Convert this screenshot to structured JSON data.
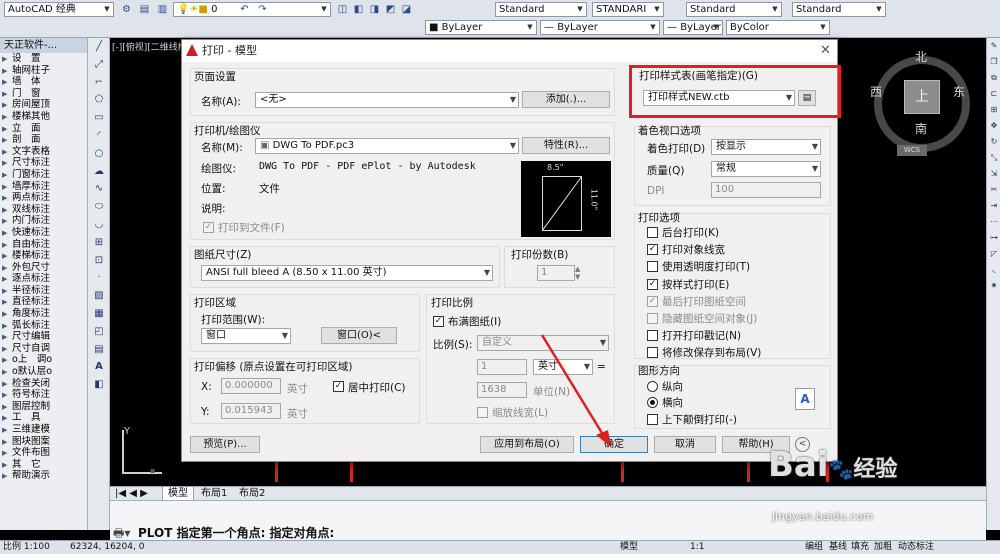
{
  "app": {
    "workspace": "AutoCAD 经典",
    "layer_value": "0",
    "style_combos": [
      "Standard",
      "STANDARI",
      "Standard",
      "Standard"
    ],
    "layer_combos": [
      "ByLayer",
      "ByLayer",
      "ByLayer",
      "ByColor"
    ]
  },
  "left_panel": {
    "title": "天正软件-...",
    "items": [
      "设　置",
      "轴网柱子",
      "墙　体",
      "门　窗",
      "房间屋顶",
      "楼梯其他",
      "立　面",
      "剖　面",
      "文字表格",
      "尺寸标注",
      "门窗标注",
      "墙厚标注",
      "两点标注",
      "双线标注",
      "内门标注",
      "快速标注",
      "自由标注",
      "楼梯标注",
      "外包尺寸",
      "逐点标注",
      "半径标注",
      "直径标注",
      "角度标注",
      "弧长标注",
      "尺寸编辑",
      "尺寸自调",
      "o上　调o",
      "o默认层o",
      "检查关闭",
      "符号标注",
      "图层控制",
      "工　具",
      "三维建模",
      "图块图案",
      "文件布图",
      "其　它",
      "帮助演示"
    ]
  },
  "viewport_label": "[-][俯视][二维线框]",
  "compass": {
    "north": "北",
    "south": "南",
    "west": "西",
    "east": "东",
    "center": "上",
    "wcs": "WCS"
  },
  "ucs": {
    "y_label": "Y"
  },
  "tabs": [
    "模型",
    "布局1",
    "布局2"
  ],
  "command": {
    "text": "PLOT 指定第一个角点: 指定对角点:"
  },
  "status": {
    "scale": "比例 1:100",
    "coords": "62324, 16204, 0",
    "model": "模型",
    "anno_scale": "1:1",
    "right_items": [
      "编组",
      "基线",
      "填充",
      "加粗",
      "动态标注"
    ]
  },
  "watermark": {
    "brand": "Bai",
    "brand_cn": "经验",
    "url": "jingyan.baidu.com"
  },
  "dialog": {
    "title": "打印 - 模型",
    "page_setup": {
      "group": "页面设置",
      "name_label": "名称(A):",
      "name_value": "<无>",
      "add_button": "添加(.)..."
    },
    "printer": {
      "group": "打印机/绘图仪",
      "name_label": "名称(M):",
      "name_value": "DWG To PDF.pc3",
      "props_button": "特性(R)...",
      "plotter_label": "绘图仪:",
      "plotter_value": "DWG To PDF - PDF ePlot - by Autodesk",
      "location_label": "位置:",
      "location_value": "文件",
      "desc_label": "说明:",
      "print_to_file": "打印到文件(F)",
      "preview_w": "8.5\"",
      "preview_h": "11.0\""
    },
    "paper_size": {
      "group": "图纸尺寸(Z)",
      "value": "ANSI full bleed A (8.50 x 11.00 英寸)"
    },
    "copies": {
      "group": "打印份数(B)",
      "value": "1"
    },
    "plot_area": {
      "group": "打印区域",
      "range_label": "打印范围(W):",
      "range_value": "窗口",
      "window_button": "窗口(O)<"
    },
    "plot_offset": {
      "group": "打印偏移 (原点设置在可打印区域)",
      "x_label": "X:",
      "x_value": "0.000000",
      "x_unit": "英寸",
      "y_label": "Y:",
      "y_value": "0.015943",
      "y_unit": "英寸",
      "center_label": "居中打印(C)"
    },
    "plot_scale": {
      "group": "打印比例",
      "fit_label": "布满图纸(I)",
      "scale_label": "比例(S):",
      "scale_value": "自定义",
      "val1": "1",
      "unit_value": "英寸",
      "val2": "1638",
      "unit_label": "单位(N)",
      "lineweight_label": "缩放线宽(L)"
    },
    "style_table": {
      "group": "打印样式表(画笔指定)(G)",
      "value": "打印样式NEW.ctb"
    },
    "shaded_viewport": {
      "group": "着色视口选项",
      "shade_label": "着色打印(D)",
      "shade_value": "按显示",
      "quality_label": "质量(Q)",
      "quality_value": "常规",
      "dpi_label": "DPI",
      "dpi_value": "100"
    },
    "plot_options": {
      "group": "打印选项",
      "items": [
        {
          "label": "后台打印(K)",
          "checked": false,
          "enabled": true
        },
        {
          "label": "打印对象线宽",
          "checked": true,
          "enabled": true
        },
        {
          "label": "使用透明度打印(T)",
          "checked": false,
          "enabled": true
        },
        {
          "label": "按样式打印(E)",
          "checked": true,
          "enabled": true
        },
        {
          "label": "最后打印图纸空间",
          "checked": true,
          "enabled": false
        },
        {
          "label": "隐藏图纸空间对象(J)",
          "checked": false,
          "enabled": false
        },
        {
          "label": "打开打印戳记(N)",
          "checked": false,
          "enabled": true
        },
        {
          "label": "将修改保存到布局(V)",
          "checked": false,
          "enabled": true
        }
      ]
    },
    "orientation": {
      "group": "图形方向",
      "portrait": "纵向",
      "landscape": "横向",
      "upside_down": "上下颠倒打印(-)"
    },
    "buttons": {
      "preview": "预览(P)...",
      "apply": "应用到布局(O)",
      "ok": "确定",
      "cancel": "取消",
      "help": "帮助(H)"
    },
    "highlight_color": "#e02020",
    "arrow_color": "#e02020"
  }
}
